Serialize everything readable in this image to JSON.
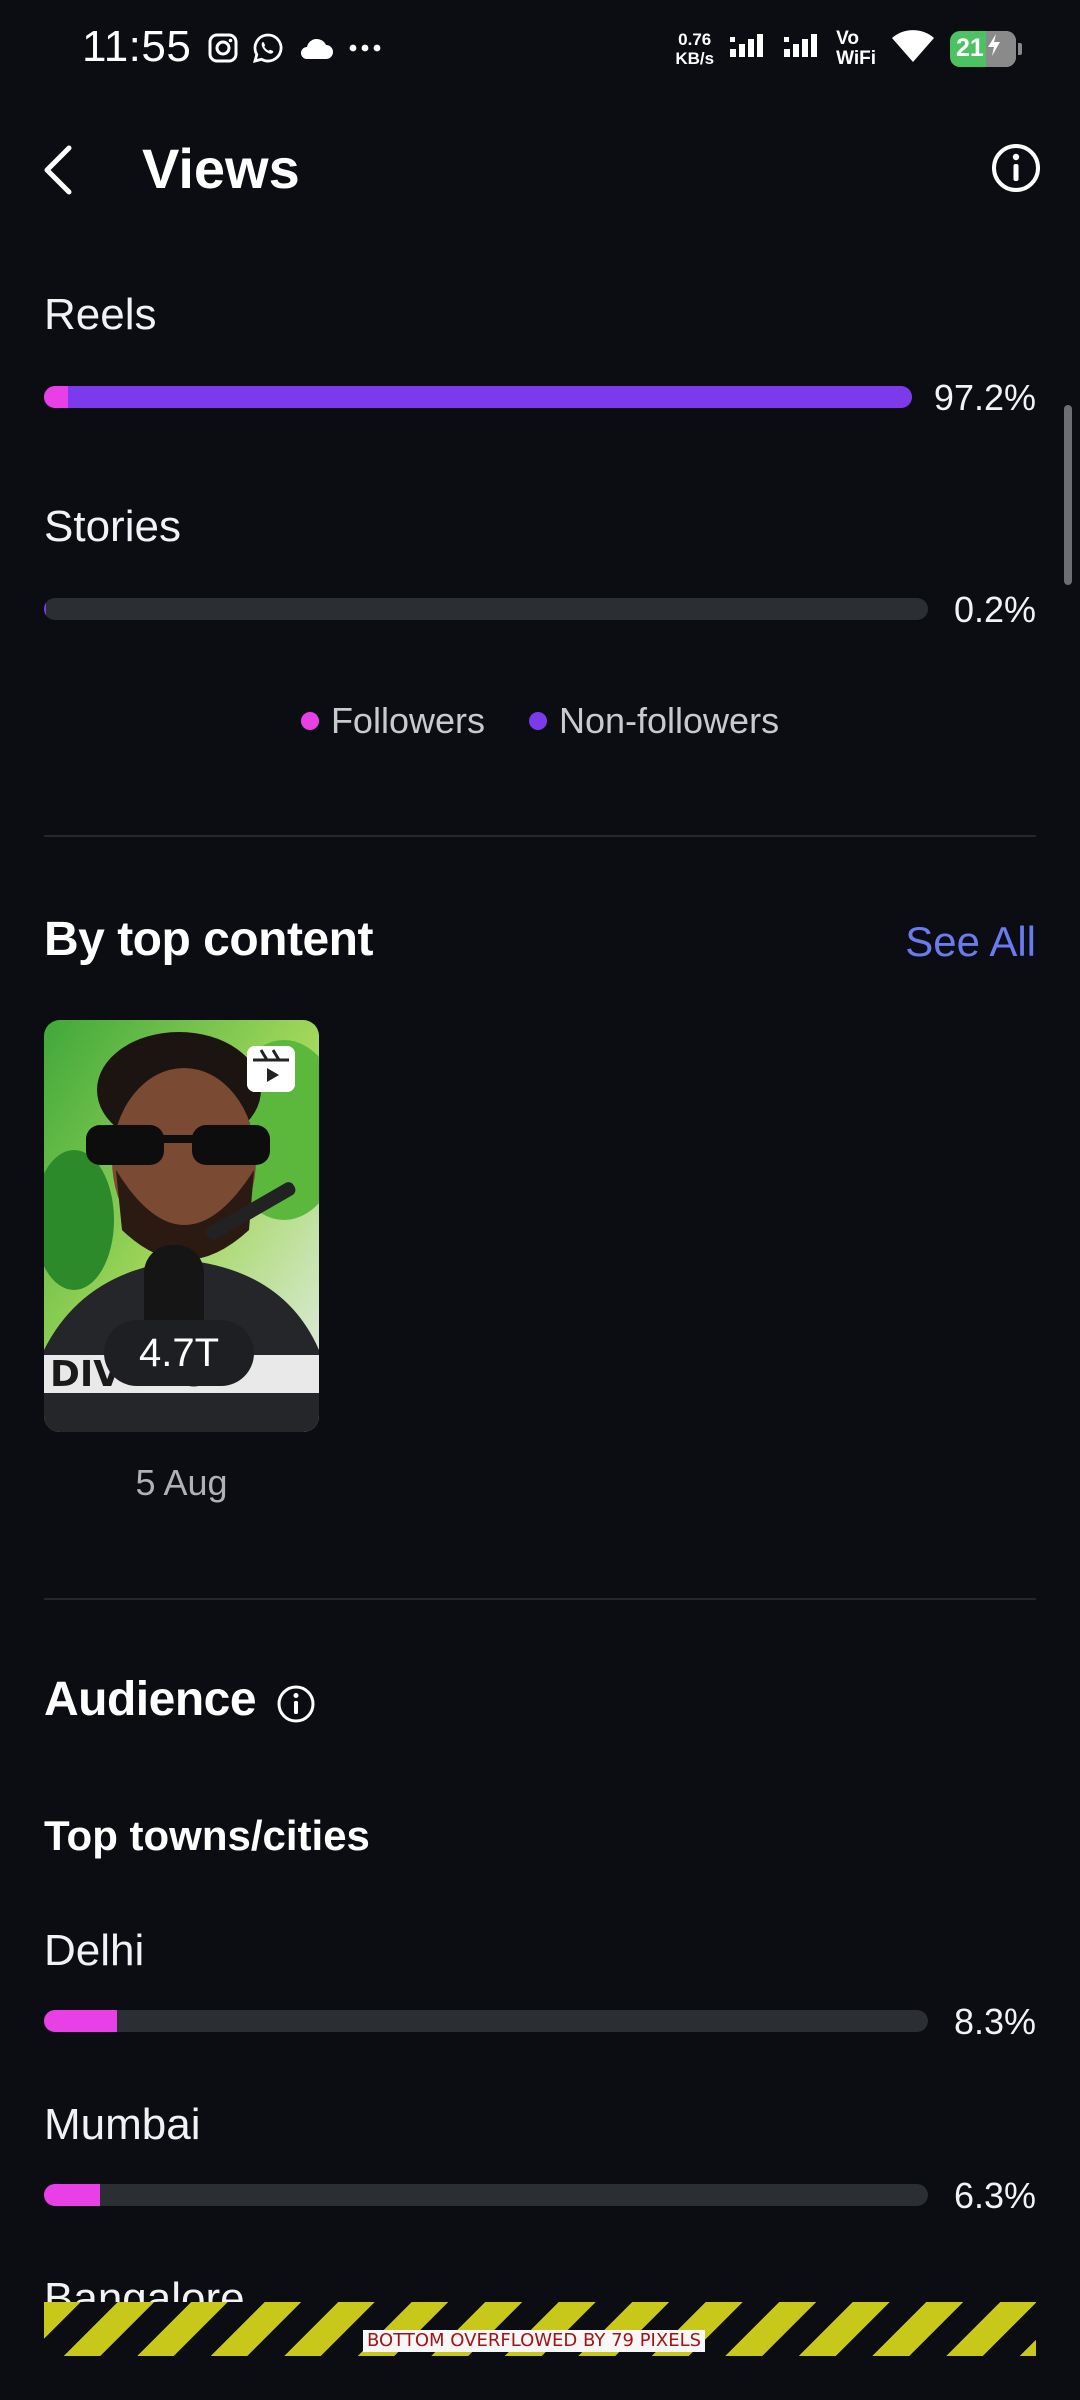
{
  "status_bar": {
    "time": "11:55",
    "net_speed_value": "0.76",
    "net_speed_unit": "KB/s",
    "vowifi_top": "Vo",
    "vowifi_bottom": "WiFi",
    "battery": "21",
    "left_icons": [
      "instagram-icon",
      "whatsapp-icon",
      "cloud-icon",
      "more-dots-icon"
    ]
  },
  "header": {
    "title": "Views"
  },
  "breakdown": {
    "rows": [
      {
        "label": "Reels",
        "percent": "97.2%",
        "followers_fraction": 0.028,
        "nonfollowers_fraction": 0.972
      },
      {
        "label": "Stories",
        "percent": "0.2%",
        "followers_fraction": 0.0,
        "nonfollowers_fraction": 0.002
      }
    ],
    "legend": [
      {
        "label": "Followers",
        "color": "#e83fe6"
      },
      {
        "label": "Non-followers",
        "color": "#7c3aed"
      }
    ]
  },
  "top_content": {
    "title": "By top content",
    "see_all": "See All",
    "items": [
      {
        "views": "4.7T",
        "date": "5 Aug",
        "shirt_text": "DIV   ING"
      }
    ]
  },
  "audience": {
    "title": "Audience",
    "subtitle": "Top towns/cities",
    "cities": [
      {
        "name": "Delhi",
        "percent": "8.3%",
        "fraction": 0.083
      },
      {
        "name": "Mumbai",
        "percent": "6.3%",
        "fraction": 0.063
      },
      {
        "name": "Bangalore"
      }
    ]
  },
  "debug": {
    "overflow_message": "BOTTOM OVERFLOWED BY 79 PIXELS"
  },
  "colors": {
    "background": "#0c0d12",
    "followers": "#e83fe6",
    "nonfollowers": "#7c3aed",
    "track": "#2b2f33",
    "link": "#6a7bf0"
  }
}
